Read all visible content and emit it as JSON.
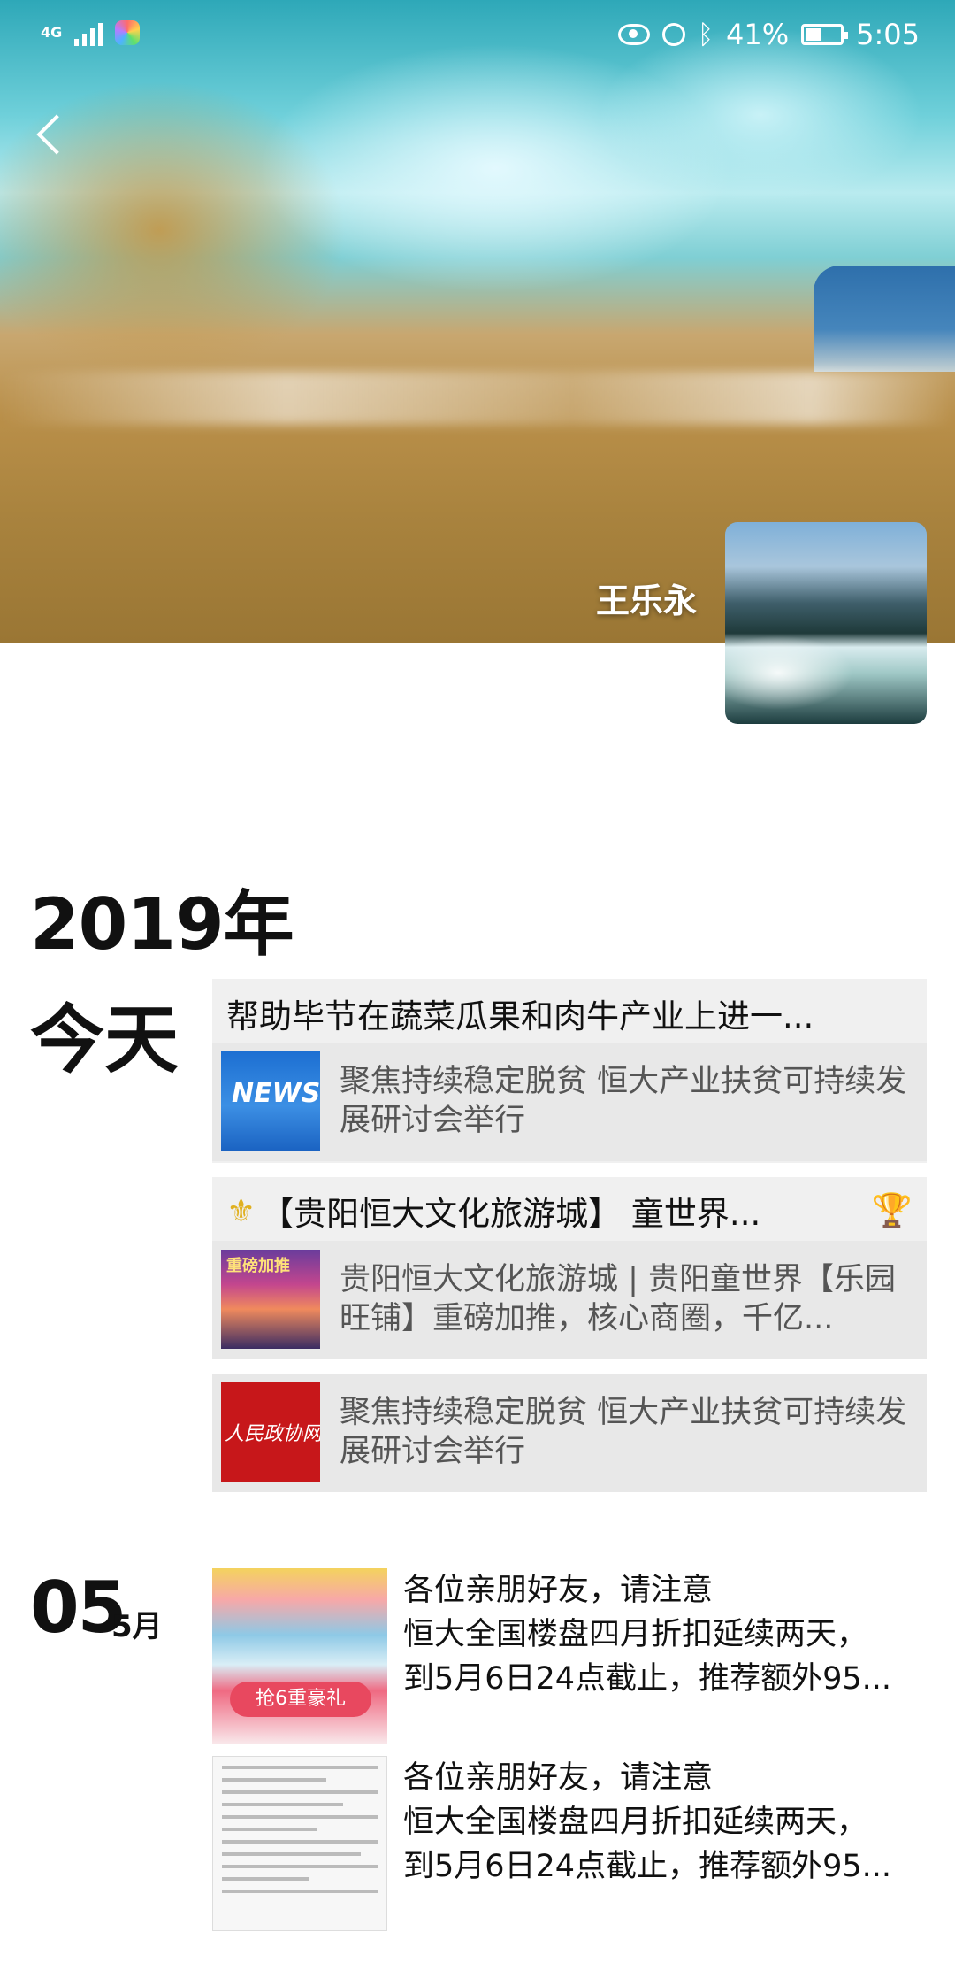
{
  "status_bar": {
    "network": "4G",
    "battery": "41%",
    "time": "5:05"
  },
  "profile": {
    "name": "王乐永"
  },
  "timeline": {
    "year": "2019年",
    "today_label": "今天",
    "today_posts": [
      {
        "title": "帮助毕节在蔬菜瓜果和肉牛产业上进一...",
        "link_text": "聚焦持续稳定脱贫 恒大产业扶贫可持续发展研讨会举行",
        "thumb_text": "NEWS"
      },
      {
        "title": "【贵阳恒大文化旅游城】 童世界...",
        "link_text": "贵阳恒大文化旅游城 | 贵阳童世界【乐园旺铺】重磅加推，核心商圈，千亿...",
        "thumb_text": "重磅加推"
      },
      {
        "link_text": "聚焦持续稳定脱贫 恒大产业扶贫可持续发展研讨会举行",
        "thumb_text": "人民政协网"
      }
    ],
    "date_group": {
      "day": "05",
      "month": "5月",
      "posts": [
        {
          "line1": "各位亲朋好友，请注意",
          "line2": "恒大全国楼盘四月折扣延续两天，",
          "line3": "到5月6日24点截止，推荐额外95...",
          "badge": "抢6重豪礼"
        },
        {
          "line1": "各位亲朋好友，请注意",
          "line2": "恒大全国楼盘四月折扣延续两天，",
          "line3": "到5月6日24点截止，推荐额外95..."
        }
      ]
    }
  },
  "icons": {
    "back": "chevron-left-icon",
    "eye": "eye-icon",
    "alarm": "alarm-icon",
    "bluetooth": "bluetooth-icon",
    "battery": "battery-icon"
  }
}
